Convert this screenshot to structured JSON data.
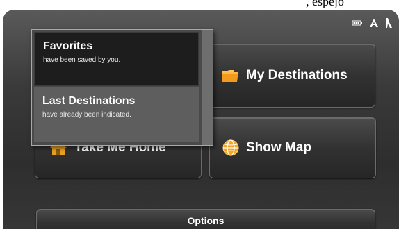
{
  "window_strip": {
    "partial_text": ", espejo"
  },
  "status_bar": {
    "icons": [
      "battery-icon",
      "gps-signal-icon",
      "satellite-icon"
    ]
  },
  "menu": {
    "my_destinations": {
      "label": "My Destinations",
      "icon": "folder-icon"
    },
    "show_map": {
      "label": "Show Map",
      "icon": "globe-icon"
    },
    "take_me_home": {
      "label": "Take Me Home",
      "icon": "home-icon"
    },
    "options": {
      "label": "Options"
    }
  },
  "popup": {
    "items": [
      {
        "title": "Favorites",
        "subtitle": "have been saved by you."
      },
      {
        "title": "Last Destinations",
        "subtitle": "have already been indicated."
      }
    ]
  },
  "colors": {
    "background": "#2e2e2e",
    "tile": "#323232",
    "folder_icon": "#f29a1c",
    "globe_icon": "#f5a623",
    "home_icon": "#e8a020",
    "popup_selected": "#1d1d1d",
    "popup_unselected": "#5e5e5e"
  }
}
